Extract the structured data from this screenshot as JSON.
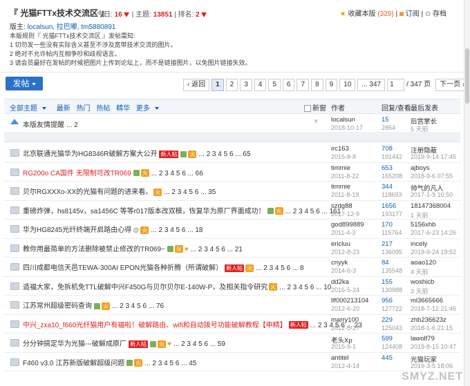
{
  "header": {
    "title": "『 光猫FTTx技术交流区 』",
    "today_label": "今日:",
    "today": "16",
    "topics_label": "主题:",
    "topics": "13851",
    "rank_label": "排名:",
    "rank": "2",
    "fav_label": "收藏本版",
    "fav_count": "(329)",
    "subscribe_label": "订阅",
    "archive_label": "存档",
    "mod_label": "版主:",
    "mod_names": "localsun, 拉巴嘟, tm5880891",
    "rules": [
      "本版规则『 光猫FTTx技术交流区 』发帖需知:",
      "1 切勿发一些没有实际含义甚至不涉及宽带技术交流的图片。",
      "2 绝对不允许帖内互相争吵和歧视语言。",
      "3 请会员最好在发帖的时候把图片上传到论坛上，而不是链接图片，以免图片链接失效。"
    ]
  },
  "toolbar": {
    "post_label": "发帖",
    "pager": {
      "back": "‹ 返回",
      "pages": [
        "1",
        "2",
        "3",
        "4",
        "5",
        "6",
        "7",
        "8",
        "9",
        "10"
      ],
      "current": "1",
      "last": "... 347",
      "input": "1",
      "total": "/ 347 页",
      "next": "下一页 ›"
    }
  },
  "listhead": {
    "tabs": [
      "全部主题",
      "最新",
      "热门",
      "热帖",
      "精华",
      "更多"
    ],
    "new_label": "新窗",
    "author": "作者",
    "reply": "回复/查看",
    "last": "最后发表"
  },
  "pinned": {
    "title": "本版友情提醒",
    "pages": "... 2",
    "author": "localsun",
    "author_date": "2018-10-17",
    "replies": "15",
    "views": "2864",
    "last_user": "后宫掌长",
    "last_time": "5 天前"
  },
  "threads": [
    {
      "title": "北京联通光猫华为HG8346R破解方案大公开",
      "red": false,
      "tags": [
        "new",
        "img",
        "hot"
      ],
      "pages": "2 3 4 5 6 ... 65",
      "author": "irc163",
      "date": "2015-8-8",
      "replies": "708",
      "views": "191442",
      "last_user": "注册隐蔽",
      "last_time": "2019-9-14 17:45"
    },
    {
      "title": "RG200o CA国件 无限制可改TR069",
      "red": true,
      "tags": [
        "img",
        "hot"
      ],
      "pages": "2 3 4 5 6 ... 66",
      "author": "timmie",
      "date": "2011-8-22",
      "replies": "653",
      "views": "165208",
      "last_user": "ajboys",
      "last_time": "2018-9-6 07:55"
    },
    {
      "title": "贝尔RGXXXo-XX的光猫有问题的进来看。",
      "red": false,
      "tags": [
        "hot"
      ],
      "pages": "2 3 4 5 6 ... 35",
      "author": "timmie",
      "date": "2011-8-19",
      "replies": "344",
      "views": "118693",
      "last_user": "帅气的凡人",
      "last_time": "2017-1-9 10:50"
    },
    {
      "title": "重磅炸弹，hs8145v，sa1456C 等等r017版本改双模，恢复华为原厂界面成功！",
      "red": false,
      "tags": [
        "img",
        "hot"
      ],
      "pages": "2 3 4 5 6 ... 161",
      "author": "szdg88",
      "date": "2017-12-9",
      "replies": "1656",
      "views": "193177",
      "last_user": "18147368004",
      "last_time": "1 天前"
    },
    {
      "title": "华为HG8245光纤终端开启路由心得",
      "red": false,
      "tags": [
        "att",
        "hot"
      ],
      "pages": "2 3 4 5 6 ... 18",
      "author": "god899889",
      "date": "2011-4-3",
      "replies": "170",
      "views": "115764",
      "last_user": "5156xhb",
      "last_time": "2017-6-23 14:26"
    },
    {
      "title": "教你用最简单的方法删除被禁止修改的TR069~",
      "red": false,
      "tags": [
        "img",
        "hot",
        "like"
      ],
      "pages": "2 3 4 5 6 ... 21",
      "author": "ericluu",
      "date": "2012-8-23",
      "replies": "217",
      "views": "136095",
      "last_user": "incely",
      "last_time": "2019-9-24 19:52"
    },
    {
      "title": "四川成都电信天邑TEWA-300AI EPON光猫各种折腾（所谓破解）",
      "red": false,
      "tags": [
        "new",
        "hot"
      ],
      "pages": "2 3 4 5 6 ... 8",
      "author": "cnyyk",
      "date": "2014-6-3",
      "replies": "84",
      "views": "135548",
      "last_user": "aoao120",
      "last_time": "4 天前"
    },
    {
      "title": "造福大家，免拆机免TTL破解中兴F450G与贝尔贝尔E-140W-P，及相关指令研究",
      "red": false,
      "tags": [
        "hot"
      ],
      "pages": "2 3 4 5 6 ... 10",
      "author": "dd2ka",
      "date": "2016-5-24",
      "replies": "155",
      "views": "130988",
      "last_user": "woshicb",
      "last_time": "3 天前"
    },
    {
      "title": "江苏常州超级密码查询",
      "red": false,
      "tags": [
        "img",
        "hot"
      ],
      "pages": "2 3 4 5 6 ... 76",
      "author": "llf000213104",
      "date": "2012-6-20",
      "replies": "956",
      "views": "127722",
      "last_user": "ml3665666",
      "last_time": "2018-7-12 21:46"
    },
    {
      "title": "中兴_zxa10_f660光纤猫用户有福啦！破解路由、wifi和自动拨号功能破解教程【申精】",
      "red": true,
      "tags": [
        "new"
      ],
      "pages": "2 3 4 5 6 ... 23",
      "author": "marry100",
      "date": "2012-5-27",
      "replies": "229",
      "views": "125043",
      "last_user": "zhb236623z",
      "last_time": "2018-1-6 21:15"
    },
    {
      "title": "分分钟搞定华为光猫---破解成原厂",
      "red": false,
      "tags": [
        "new",
        "img",
        "hot",
        "like"
      ],
      "pages": "2 3 4 5 6 ... 59",
      "author": "老头Xp",
      "date": "2015-9-1",
      "replies": "599",
      "views": "124408",
      "last_user": "lawolf79",
      "last_time": "2019-8-15 10:47"
    },
    {
      "title": "F460 v3.0 江苏新版破解超级问题",
      "red": false,
      "tags": [
        "img",
        "hot"
      ],
      "pages": "2 3 4 5 6 ... 45",
      "author": "antitel",
      "date": "2012-4-14",
      "replies": "445",
      "views": "",
      "last_user": "光猫玩家",
      "last_time": "2019-3-5 18:06"
    }
  ],
  "watermark": "SMYZ.NET"
}
